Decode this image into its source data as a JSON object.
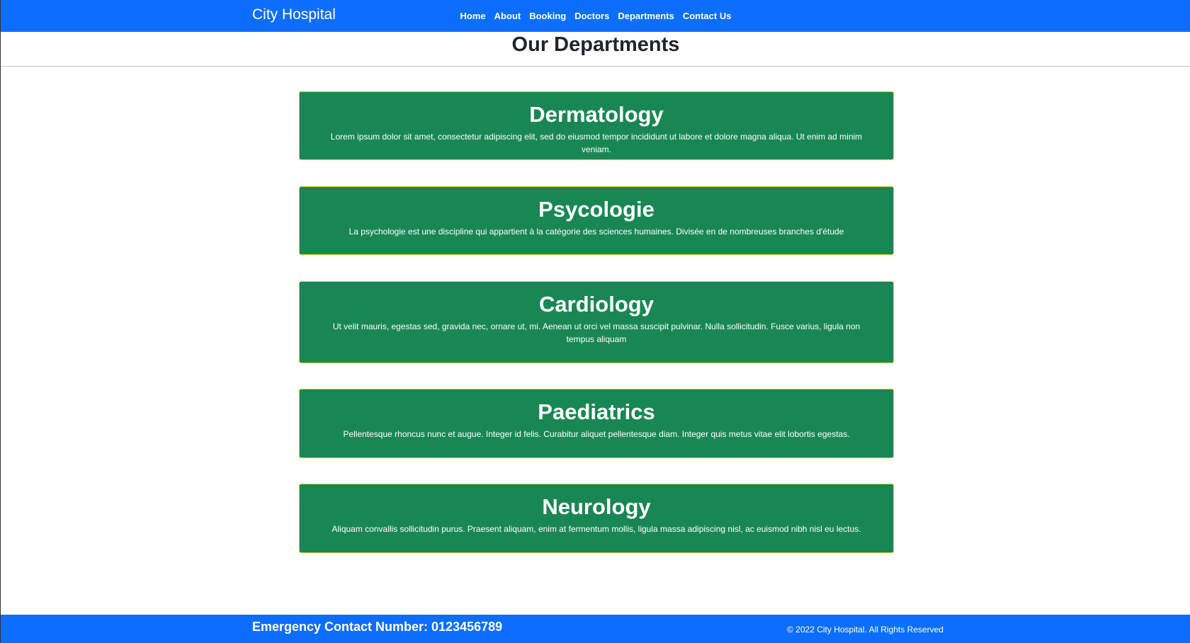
{
  "navbar": {
    "brand": "City Hospital",
    "links": [
      "Home",
      "About",
      "Booking",
      "Doctors",
      "Departments",
      "Contact Us"
    ]
  },
  "page_title": "Our Departments",
  "departments": [
    {
      "name": "Dermatology",
      "description": "Lorem ipsum dolor sit amet, consectetur adipiscing elit, sed do eiusmod tempor incididunt ut labore et dolore magna aliqua. Ut enim ad minim veniam."
    },
    {
      "name": "Psycologie",
      "description": "La psychologie est une discipline qui appartient à la catégorie des sciences humaines. Divisée en de nombreuses branches d'étude"
    },
    {
      "name": "Cardiology",
      "description": "Ut velit mauris, egestas sed, gravida nec, ornare ut, mi. Aenean ut orci vel massa suscipit pulvinar. Nulla sollicitudin. Fusce varius, ligula non tempus aliquam"
    },
    {
      "name": "Paediatrics",
      "description": "Pellentesque rhoncus nunc et augue. Integer id felis. Curabitur aliquet pellentesque diam. Integer quis metus vitae elit lobortis egestas."
    },
    {
      "name": "Neurology",
      "description": "Aliquam convallis sollicitudin purus. Praesent aliquam, enim at fermentum mollis, ligula massa adipiscing nisl, ac euismod nibh nisl eu lectus."
    }
  ],
  "footer": {
    "emergency": "Emergency Contact Number: 0123456789",
    "copyright": "© 2022 City Hospital. All Rights Reserved"
  },
  "colors": {
    "primary": "#0d6efd",
    "card_bg": "#198754",
    "card_border": "#c9d12e"
  }
}
